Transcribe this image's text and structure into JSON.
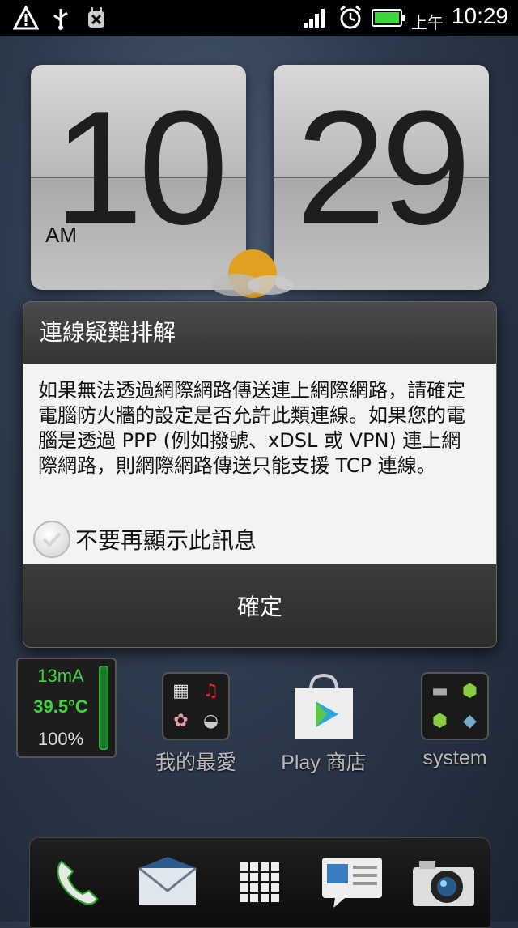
{
  "status_bar": {
    "ampm": "上午",
    "time": "10:29",
    "icons": [
      "warning-icon",
      "usb-icon",
      "debug-icon",
      "signal-icon",
      "alarm-icon",
      "battery-icon"
    ]
  },
  "clock": {
    "hours": "10",
    "minutes": "29",
    "ampm": "AM"
  },
  "dialog": {
    "title": "連線疑難排解",
    "message": "如果無法透過網際網路傳送連上網際網路，請確定電腦防火牆的設定是否允許此類連線。如果您的電腦是透過 PPP (例如撥號、xDSL 或 VPN) 連上網際網路，則網際網路傳送只能支援 TCP 連線。",
    "checkbox_label": "不要再顯示此訊息",
    "checkbox_checked": false,
    "ok_label": "確定"
  },
  "battery_widget": {
    "current": "13mA",
    "temperature": "39.5°C",
    "level": "100%"
  },
  "apps": [
    {
      "label": "我的最愛",
      "icon": "favorites-folder-icon"
    },
    {
      "label": "Play 商店",
      "icon": "play-store-icon"
    },
    {
      "label": "system",
      "icon": "system-folder-icon"
    }
  ],
  "dock": [
    "phone-icon",
    "mail-icon",
    "app-drawer-icon",
    "messages-icon",
    "camera-icon"
  ]
}
